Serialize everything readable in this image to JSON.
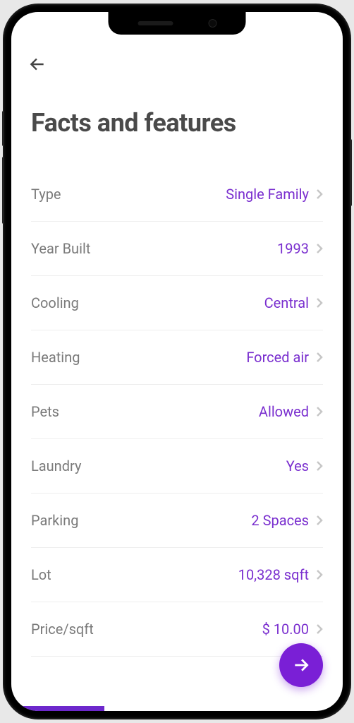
{
  "header": {
    "title": "Facts and features"
  },
  "facts": [
    {
      "label": "Type",
      "value": "Single Family"
    },
    {
      "label": "Year Built",
      "value": "1993"
    },
    {
      "label": "Cooling",
      "value": "Central"
    },
    {
      "label": "Heating",
      "value": "Forced air"
    },
    {
      "label": "Pets",
      "value": "Allowed"
    },
    {
      "label": "Laundry",
      "value": "Yes"
    },
    {
      "label": "Parking",
      "value": "2 Spaces"
    },
    {
      "label": "Lot",
      "value": "10,328 sqft"
    },
    {
      "label": "Price/sqft",
      "value": "$ 10.00"
    }
  ]
}
